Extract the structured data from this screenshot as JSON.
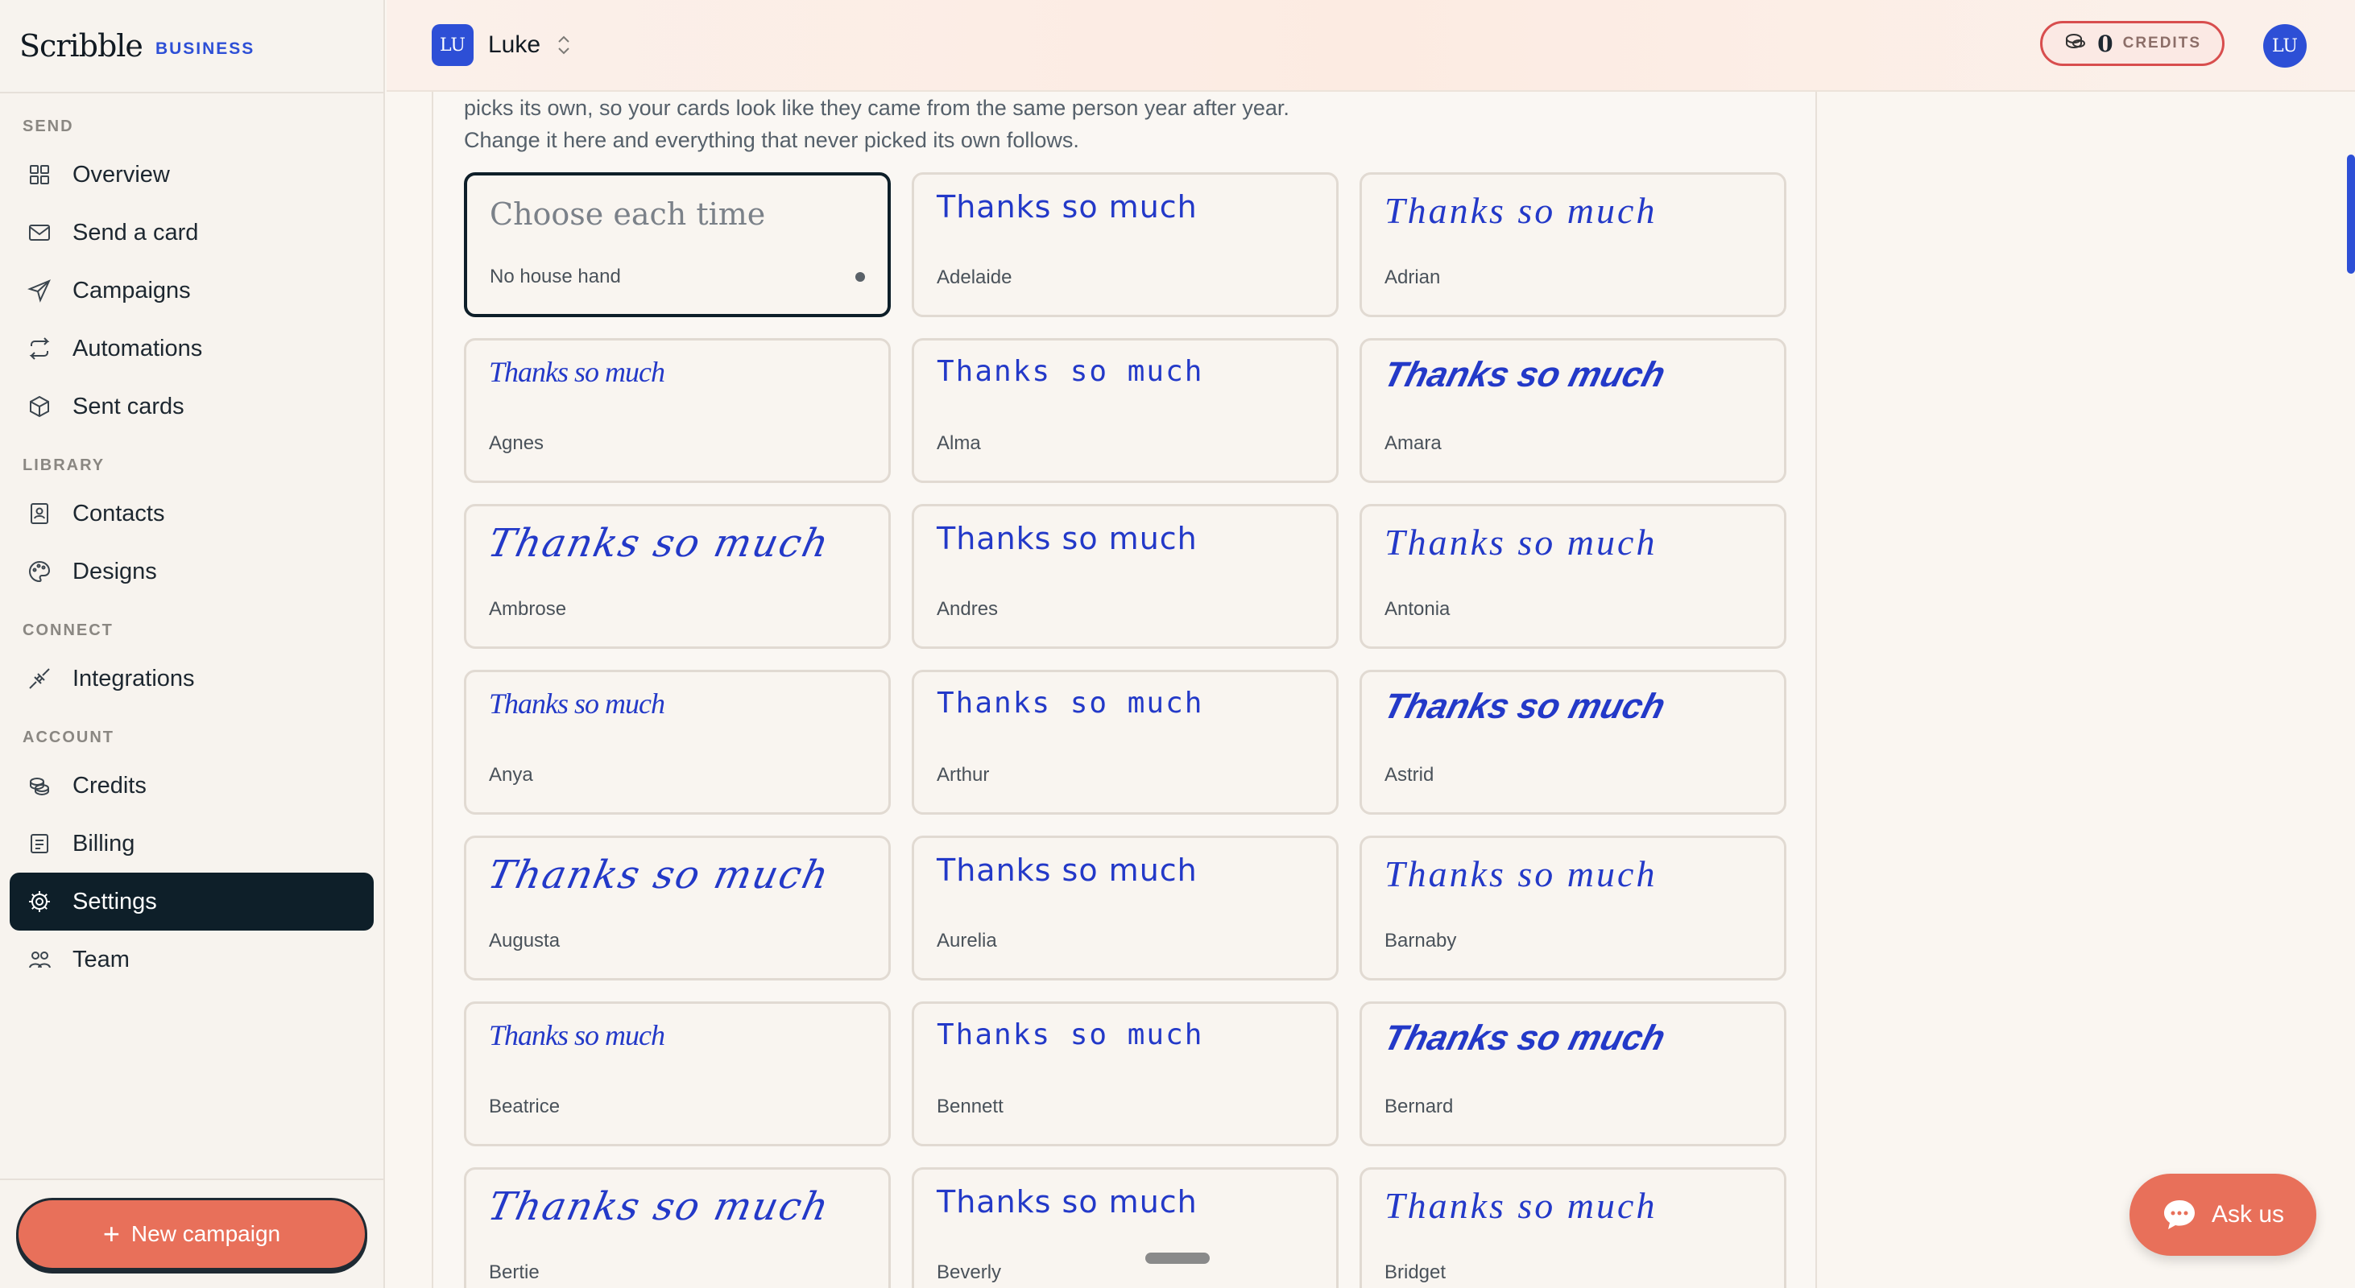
{
  "brand": {
    "name": "Scribble",
    "tag": "BUSINESS"
  },
  "sidebar": {
    "sections": [
      {
        "label": "SEND",
        "items": [
          {
            "label": "Overview",
            "icon": "grid-icon"
          },
          {
            "label": "Send a card",
            "icon": "envelope-icon"
          },
          {
            "label": "Campaigns",
            "icon": "paper-plane-icon"
          },
          {
            "label": "Automations",
            "icon": "repeat-icon"
          },
          {
            "label": "Sent cards",
            "icon": "package-icon"
          }
        ]
      },
      {
        "label": "LIBRARY",
        "items": [
          {
            "label": "Contacts",
            "icon": "contacts-book-icon"
          },
          {
            "label": "Designs",
            "icon": "palette-icon"
          }
        ]
      },
      {
        "label": "CONNECT",
        "items": [
          {
            "label": "Integrations",
            "icon": "plug-icon"
          }
        ]
      },
      {
        "label": "ACCOUNT",
        "items": [
          {
            "label": "Credits",
            "icon": "coins-icon"
          },
          {
            "label": "Billing",
            "icon": "receipt-icon"
          },
          {
            "label": "Settings",
            "icon": "gear-icon",
            "active": true
          },
          {
            "label": "Team",
            "icon": "users-icon"
          }
        ]
      }
    ],
    "new_campaign_label": "New campaign"
  },
  "topbar": {
    "workspace_initials": "LU",
    "workspace_name": "Luke",
    "credits_value": "0",
    "credits_label": "CREDITS",
    "user_initials": "LU"
  },
  "main": {
    "intro_line1": "picks its own, so your cards look like they came from the same person year after year.",
    "intro_line2": "Change it here and everything that never picked its own follows.",
    "hands": [
      {
        "sample": "Choose each time",
        "name": "No house hand",
        "selected": true
      },
      {
        "sample": "Thanks so much",
        "name": "Adelaide"
      },
      {
        "sample": "Thanks so much",
        "name": "Adrian"
      },
      {
        "sample": "Thanks so much",
        "name": "Agnes"
      },
      {
        "sample": "Thanks so much",
        "name": "Alma"
      },
      {
        "sample": "Thanks so much",
        "name": "Amara"
      },
      {
        "sample": "Thanks so much",
        "name": "Ambrose"
      },
      {
        "sample": "Thanks so much",
        "name": "Andres"
      },
      {
        "sample": "Thanks so much",
        "name": "Antonia"
      },
      {
        "sample": "Thanks so much",
        "name": "Anya"
      },
      {
        "sample": "Thanks so much",
        "name": "Arthur"
      },
      {
        "sample": "Thanks so much",
        "name": "Astrid"
      },
      {
        "sample": "Thanks so much",
        "name": "Augusta"
      },
      {
        "sample": "Thanks so much",
        "name": "Aurelia"
      },
      {
        "sample": "Thanks so much",
        "name": "Barnaby"
      },
      {
        "sample": "Thanks so much",
        "name": "Beatrice"
      },
      {
        "sample": "Thanks so much",
        "name": "Bennett"
      },
      {
        "sample": "Thanks so much",
        "name": "Bernard"
      },
      {
        "sample": "Thanks so much",
        "name": "Bertie"
      },
      {
        "sample": "Thanks so much",
        "name": "Beverly"
      },
      {
        "sample": "Thanks so much",
        "name": "Bridget"
      }
    ]
  },
  "chat": {
    "label": "Ask us"
  },
  "colors": {
    "accent": "#e8705a",
    "brand_blue": "#2d4fd6",
    "ink_blue": "#2339c8",
    "active_nav": "#0e1f29"
  }
}
